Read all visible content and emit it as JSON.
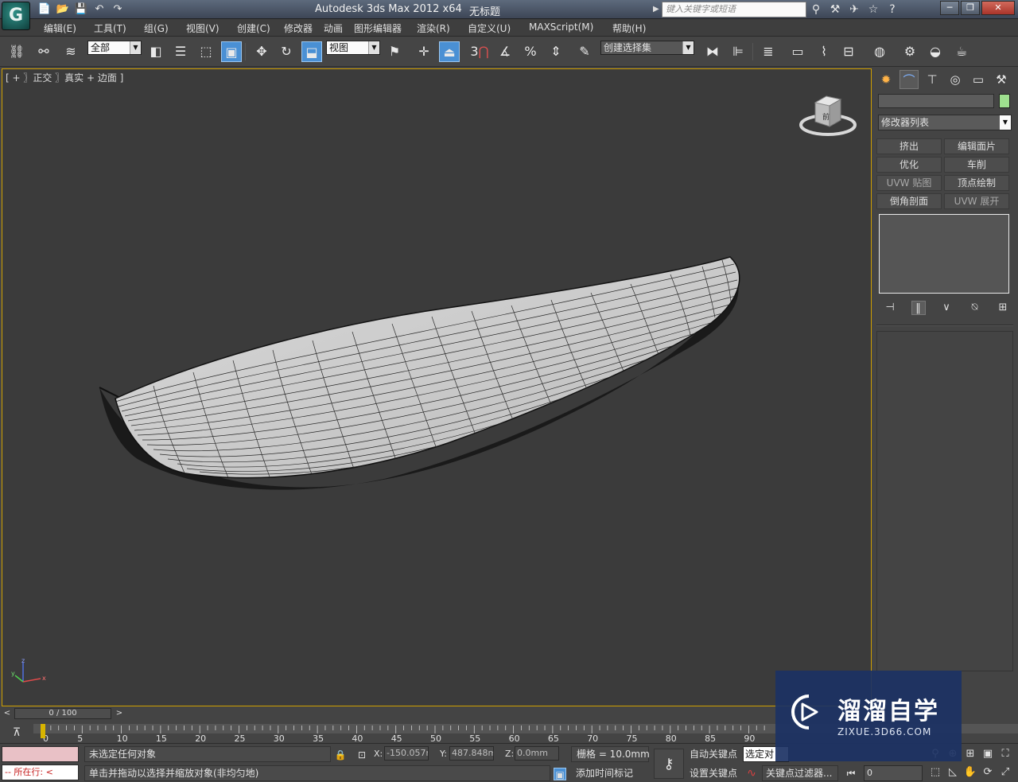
{
  "window": {
    "app_logo": "G",
    "title": "Autodesk 3ds Max  2012 x64",
    "document": "无标题",
    "search_placeholder": "键入关键字或短语",
    "controls": {
      "minimize": "─",
      "restore": "❐",
      "close": "✕"
    }
  },
  "quick_access": [
    "📄",
    "📂",
    "💾",
    "↶",
    "↷"
  ],
  "menu": [
    "编辑(E)",
    "工具(T)",
    "组(G)",
    "视图(V)",
    "创建(C)",
    "修改器",
    "动画",
    "图形编辑器",
    "渲染(R)",
    "自定义(U)",
    "MAXScript(M)",
    "帮助(H)"
  ],
  "toolbar": {
    "selection_filter": "全部",
    "ref_coord": "视图",
    "named_selection": "创建选择集",
    "snap_3": "3"
  },
  "viewport": {
    "label": "[ + 〗正交 〗真实 + 边面 ]",
    "viewcube_face": "前",
    "axis_labels": {
      "x": "x",
      "y": "y",
      "z": "z"
    },
    "colors": {
      "background": "#3b3b3b",
      "active_border": "#d0a000",
      "mesh_fill": "#d6d6d6",
      "mesh_wire": "#1c1c1c"
    }
  },
  "command_panel": {
    "tabs": [
      "create-icon",
      "modify-icon",
      "hierarchy-icon",
      "motion-icon",
      "display-icon",
      "utilities-icon"
    ],
    "modifier_list": "修改器列表",
    "object_color": "#9fe08f",
    "modifier_buttons": [
      {
        "label": "挤出",
        "enabled": true
      },
      {
        "label": "编辑面片",
        "enabled": true
      },
      {
        "label": "优化",
        "enabled": true
      },
      {
        "label": "车削",
        "enabled": true
      },
      {
        "label": "UVW 贴图",
        "enabled": false
      },
      {
        "label": "顶点绘制",
        "enabled": true
      },
      {
        "label": "倒角剖面",
        "enabled": true
      },
      {
        "label": "UVW 展开",
        "enabled": false
      }
    ]
  },
  "time_slider": {
    "position": "0 / 100",
    "prev": "<",
    "next": ">"
  },
  "track_bar": {
    "ticks": [
      "0",
      "5",
      "10",
      "15",
      "20",
      "25",
      "30",
      "35",
      "40",
      "45",
      "50",
      "55",
      "60",
      "65",
      "70",
      "75",
      "80",
      "85",
      "90"
    ]
  },
  "status": {
    "running_label": "-- 所在行: <",
    "selection_info": "未选定任何对象",
    "prompt": "单击并拖动以选择并缩放对象(非均匀地)",
    "x_label": "X:",
    "x_value": "-150.057m",
    "y_label": "Y:",
    "y_value": "487.848mm",
    "z_label": "Z:",
    "z_value": "0.0mm",
    "grid": "栅格 = 10.0mm",
    "add_time_tag": "添加时间标记",
    "auto_key": "自动关键点",
    "set_key": "设置关键点",
    "selected_dropdown": "选定对",
    "key_filters": "关键点过滤器...",
    "frame": "0"
  },
  "watermark": {
    "title": "溜溜自学",
    "url": "ZIXUE.3D66.COM"
  }
}
